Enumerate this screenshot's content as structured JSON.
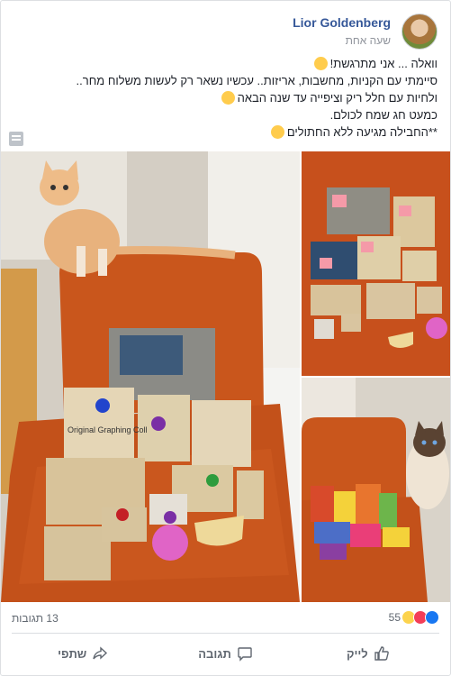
{
  "post": {
    "author": "Lior Goldenberg",
    "timestamp": "שעה אחת",
    "lines": [
      "וואלה ... אני מתרגשת!",
      "סיימתי עם הקניות, מחשבות, אריזות.. עכשיו נשאר רק לעשות משלוח מחר..",
      "ולחיות עם חלל ריק וציפייה עד שנה הבאה",
      "כמעט חג שמח לכולם.",
      "**החבילה מגיעה ללא החתולים"
    ]
  },
  "photos": {
    "main_text": "Original Graphing Coll"
  },
  "stats": {
    "reactions_count": "55",
    "comments_count": "13 תגובות"
  },
  "actions": {
    "like": "לייק",
    "comment": "תגובה",
    "share": "שתפי"
  },
  "icons": {
    "like": "like-icon",
    "comment": "comment-icon",
    "share": "share-icon",
    "note": "note-icon"
  },
  "colors": {
    "author": "#365899",
    "like_blue": "#1877f2",
    "love_red": "#f33e58",
    "wow_yellow": "#fcd34d",
    "chair_orange": "#c9561c"
  }
}
